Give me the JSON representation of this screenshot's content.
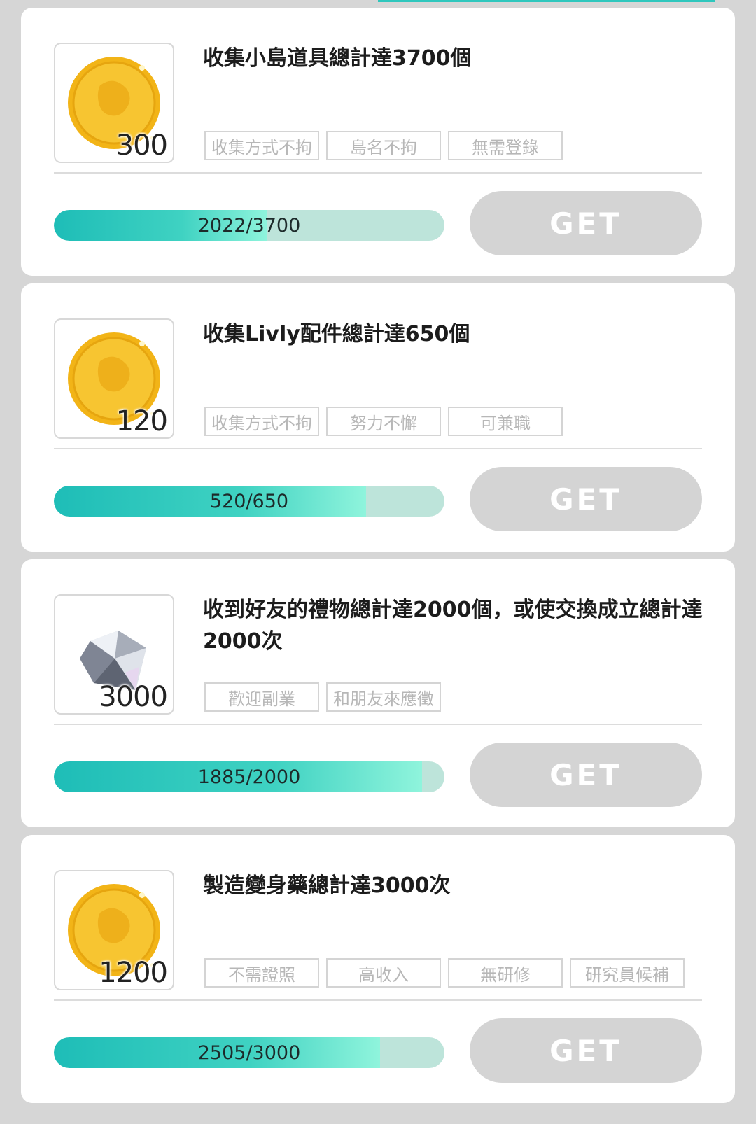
{
  "missions": [
    {
      "title": "收集小島道具總計達3700個",
      "reward_icon": "gold-coin-icon",
      "reward_count": "300",
      "tags": [
        "收集方式不拘",
        "島名不拘",
        "無需登錄"
      ],
      "progress_text": "2022/3700",
      "progress_fraction": 0.5465,
      "button_label": "GET"
    },
    {
      "title": "收集Livly配件總計達650個",
      "reward_icon": "gold-coin-icon",
      "reward_count": "120",
      "tags": [
        "收集方式不拘",
        "努力不懈",
        "可兼職"
      ],
      "progress_text": "520/650",
      "progress_fraction": 0.8,
      "button_label": "GET"
    },
    {
      "title": "收到好友的禮物總計達2000個，或使交換成立總計達2000次",
      "reward_icon": "diamond-icon",
      "reward_count": "3000",
      "tags": [
        "歡迎副業",
        "和朋友來應徵"
      ],
      "progress_text": "1885/2000",
      "progress_fraction": 0.9425,
      "button_label": "GET"
    },
    {
      "title": "製造變身藥總計達3000次",
      "reward_icon": "gold-coin-icon",
      "reward_count": "1200",
      "tags": [
        "不需證照",
        "高收入",
        "無研修",
        "研究員候補"
      ],
      "progress_text": "2505/3000",
      "progress_fraction": 0.835,
      "button_label": "GET"
    }
  ]
}
